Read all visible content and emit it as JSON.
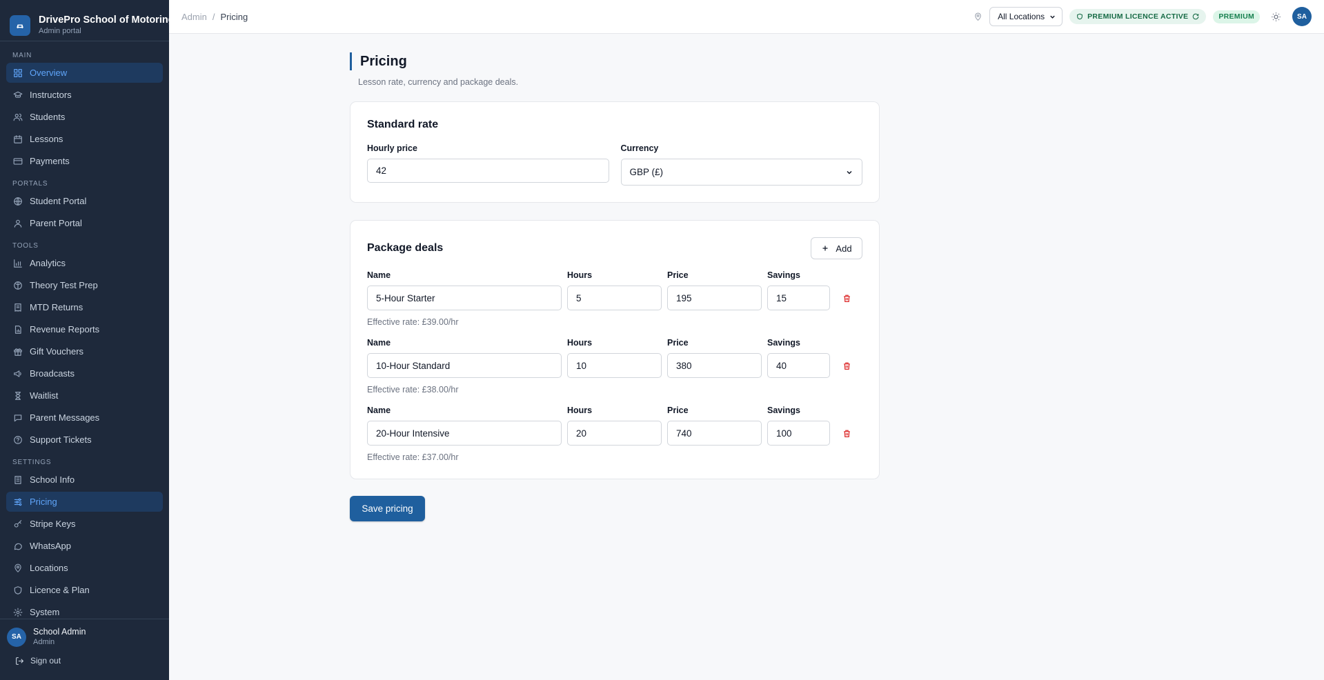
{
  "brand": {
    "title": "DrivePro School of Motoring",
    "subtitle": "Admin portal"
  },
  "sidebar": {
    "sections": [
      {
        "label": "MAIN",
        "items": [
          {
            "label": "Overview",
            "icon": "grid-icon",
            "active": true
          },
          {
            "label": "Instructors",
            "icon": "graduation-cap-icon"
          },
          {
            "label": "Students",
            "icon": "users-icon"
          },
          {
            "label": "Lessons",
            "icon": "calendar-icon"
          },
          {
            "label": "Payments",
            "icon": "credit-card-icon"
          }
        ]
      },
      {
        "label": "PORTALS",
        "items": [
          {
            "label": "Student Portal",
            "icon": "globe-icon"
          },
          {
            "label": "Parent Portal",
            "icon": "user-icon"
          }
        ]
      },
      {
        "label": "TOOLS",
        "items": [
          {
            "label": "Analytics",
            "icon": "bar-chart-icon"
          },
          {
            "label": "Theory Test Prep",
            "icon": "brain-icon"
          },
          {
            "label": "MTD Returns",
            "icon": "receipt-icon"
          },
          {
            "label": "Revenue Reports",
            "icon": "file-chart-icon"
          },
          {
            "label": "Gift Vouchers",
            "icon": "gift-icon"
          },
          {
            "label": "Broadcasts",
            "icon": "megaphone-icon"
          },
          {
            "label": "Waitlist",
            "icon": "hourglass-icon"
          },
          {
            "label": "Parent Messages",
            "icon": "message-icon"
          },
          {
            "label": "Support Tickets",
            "icon": "help-circle-icon"
          }
        ]
      },
      {
        "label": "SETTINGS",
        "items": [
          {
            "label": "School Info",
            "icon": "building-icon"
          },
          {
            "label": "Pricing",
            "icon": "sliders-icon",
            "active": true
          },
          {
            "label": "Stripe Keys",
            "icon": "key-icon"
          },
          {
            "label": "WhatsApp",
            "icon": "chat-bubble-icon"
          },
          {
            "label": "Locations",
            "icon": "map-pin-icon"
          },
          {
            "label": "Licence & Plan",
            "icon": "shield-icon"
          },
          {
            "label": "System",
            "icon": "gear-icon"
          }
        ]
      }
    ]
  },
  "user": {
    "initials": "SA",
    "name": "School Admin",
    "role": "Admin",
    "signout_label": "Sign out"
  },
  "header": {
    "breadcrumb_root": "Admin",
    "breadcrumb_sep": "/",
    "breadcrumb_current": "Pricing",
    "location_selected": "All Locations",
    "licence_badge": "PREMIUM LICENCE ACTIVE",
    "plan_badge": "PREMIUM",
    "avatar_initials": "SA"
  },
  "page": {
    "title": "Pricing",
    "subtitle": "Lesson rate, currency and package deals."
  },
  "standard_rate": {
    "title": "Standard rate",
    "hourly_label": "Hourly price",
    "hourly_value": "42",
    "currency_label": "Currency",
    "currency_value": "GBP (£)"
  },
  "packages": {
    "title": "Package deals",
    "add_label": "Add",
    "col_name": "Name",
    "col_hours": "Hours",
    "col_price": "Price",
    "col_savings": "Savings",
    "rows": [
      {
        "name": "5-Hour Starter",
        "hours": "5",
        "price": "195",
        "savings": "15",
        "effective": "Effective rate: £39.00/hr"
      },
      {
        "name": "10-Hour Standard",
        "hours": "10",
        "price": "380",
        "savings": "40",
        "effective": "Effective rate: £38.00/hr"
      },
      {
        "name": "20-Hour Intensive",
        "hours": "20",
        "price": "740",
        "savings": "100",
        "effective": "Effective rate: £37.00/hr"
      }
    ]
  },
  "actions": {
    "save_label": "Save pricing"
  },
  "colors": {
    "accent": "#1f5f9e",
    "sidebar_bg": "#1e293b",
    "danger": "#dc2626",
    "success": "#166a45"
  }
}
